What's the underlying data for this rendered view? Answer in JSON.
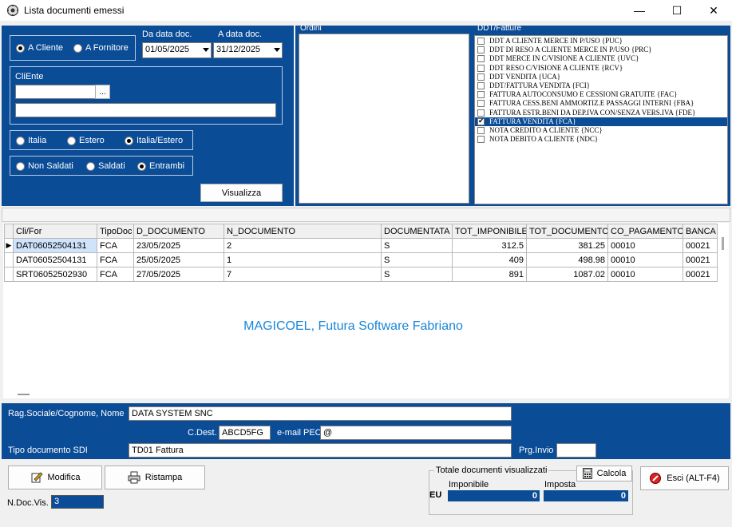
{
  "window": {
    "title": "Lista documenti emessi",
    "minimize": "—",
    "maximize": "☐",
    "close": "✕"
  },
  "filters": {
    "tipo_soggetto": [
      {
        "label": "A Cliente",
        "checked": true
      },
      {
        "label": "A Fornitore",
        "checked": false
      }
    ],
    "da_data_label": "Da data doc.",
    "da_data_value": "01/05/2025",
    "a_data_label": "A data doc.",
    "a_data_value": "31/12/2025",
    "cliente_label": "CliEnte",
    "cliente_code": "",
    "cliente_lookup": "...",
    "cliente_name": "",
    "area": [
      {
        "label": "Italia",
        "checked": false
      },
      {
        "label": "Estero",
        "checked": false
      },
      {
        "label": "Italia/Estero",
        "checked": true
      }
    ],
    "saldo": [
      {
        "label": "Non Saldati",
        "checked": false
      },
      {
        "label": "Saldati",
        "checked": false
      },
      {
        "label": "Entrambi",
        "checked": true
      }
    ],
    "visualizza_label": "Visualizza"
  },
  "ordini": {
    "title": "Ordini",
    "items": []
  },
  "ddt_fatture": {
    "title": "DDT/Fatture",
    "items": [
      {
        "label": "DDT A CLIENTE MERCE IN P/USO {PUC}",
        "checked": false,
        "selected": false
      },
      {
        "label": "DDT DI RESO A CLIENTE MERCE IN P/USO {PRC}",
        "checked": false,
        "selected": false
      },
      {
        "label": "DDT MERCE IN C/VISIONE A CLIENTE {UVC}",
        "checked": false,
        "selected": false
      },
      {
        "label": "DDT RESO C/VISIONE A CLIENTE {RCV}",
        "checked": false,
        "selected": false
      },
      {
        "label": "DDT VENDITA {UCA}",
        "checked": false,
        "selected": false
      },
      {
        "label": "DDT/FATTURA VENDITA {FCI}",
        "checked": false,
        "selected": false
      },
      {
        "label": "FATTURA AUTOCONSUMO E CESSIONI GRATUITE {FAC}",
        "checked": false,
        "selected": false
      },
      {
        "label": "FATTURA CESS.BENI AMMORTIZ.E PASSAGGI INTERNI {FBA}",
        "checked": false,
        "selected": false
      },
      {
        "label": "FATTURA ESTR.BENI DA DEP.IVA CON/SENZA VERS.IVA {FDE}",
        "checked": false,
        "selected": false
      },
      {
        "label": "FATTURA VENDITA {FCA}",
        "checked": true,
        "selected": true
      },
      {
        "label": "NOTA CREDITO A CLIENTE {NCC}",
        "checked": false,
        "selected": false
      },
      {
        "label": "NOTA DEBITO A CLIENTE {NDC}",
        "checked": false,
        "selected": false
      }
    ]
  },
  "grid": {
    "columns": [
      "Cli/For",
      "TipoDoc",
      "D_DOCUMENTO",
      "N_DOCUMENTO",
      "DOCUMENTATA",
      "TOT_IMPONIBILE",
      "TOT_DOCUMENTO",
      "CO_PAGAMENTO",
      "BANCA"
    ],
    "rows": [
      [
        "DAT06052504131",
        "FCA",
        "23/05/2025",
        "2",
        "S",
        "312.5",
        "381.25",
        "00010",
        "00021"
      ],
      [
        "DAT06052504131",
        "FCA",
        "25/05/2025",
        "1",
        "S",
        "409",
        "498.98",
        "00010",
        "00021"
      ],
      [
        "SRT06052502930",
        "FCA",
        "27/05/2025",
        "7",
        "S",
        "891",
        "1087.02",
        "00010",
        "00021"
      ]
    ],
    "watermark": "MAGICOEL, Futura Software Fabriano"
  },
  "detail": {
    "rag_label": "Rag.Sociale/Cognome, Nome",
    "rag_value": "DATA SYSTEM SNC",
    "cdest_label": "C.Dest.",
    "cdest_value": "ABCD5FG",
    "pec_label": "e-mail PEC",
    "pec_value": "@",
    "tipo_sdi_label": "Tipo documento SDI",
    "tipo_sdi_value": "TD01 Fattura",
    "prg_label": "Prg.Invio",
    "prg_value": ""
  },
  "bottom": {
    "modifica": "Modifica",
    "ristampa": "Ristampa",
    "ndoc_label": "N.Doc.Vis.",
    "ndoc_value": "3",
    "totali_title": "Totale documenti visualizzati",
    "calcola": "Calcola",
    "currency": "EU",
    "imponibile_label": "Imponibile",
    "imponibile_value": "0",
    "imposta_label": "Imposta",
    "imposta_value": "0",
    "esci": "Esci (ALT-F4)"
  }
}
